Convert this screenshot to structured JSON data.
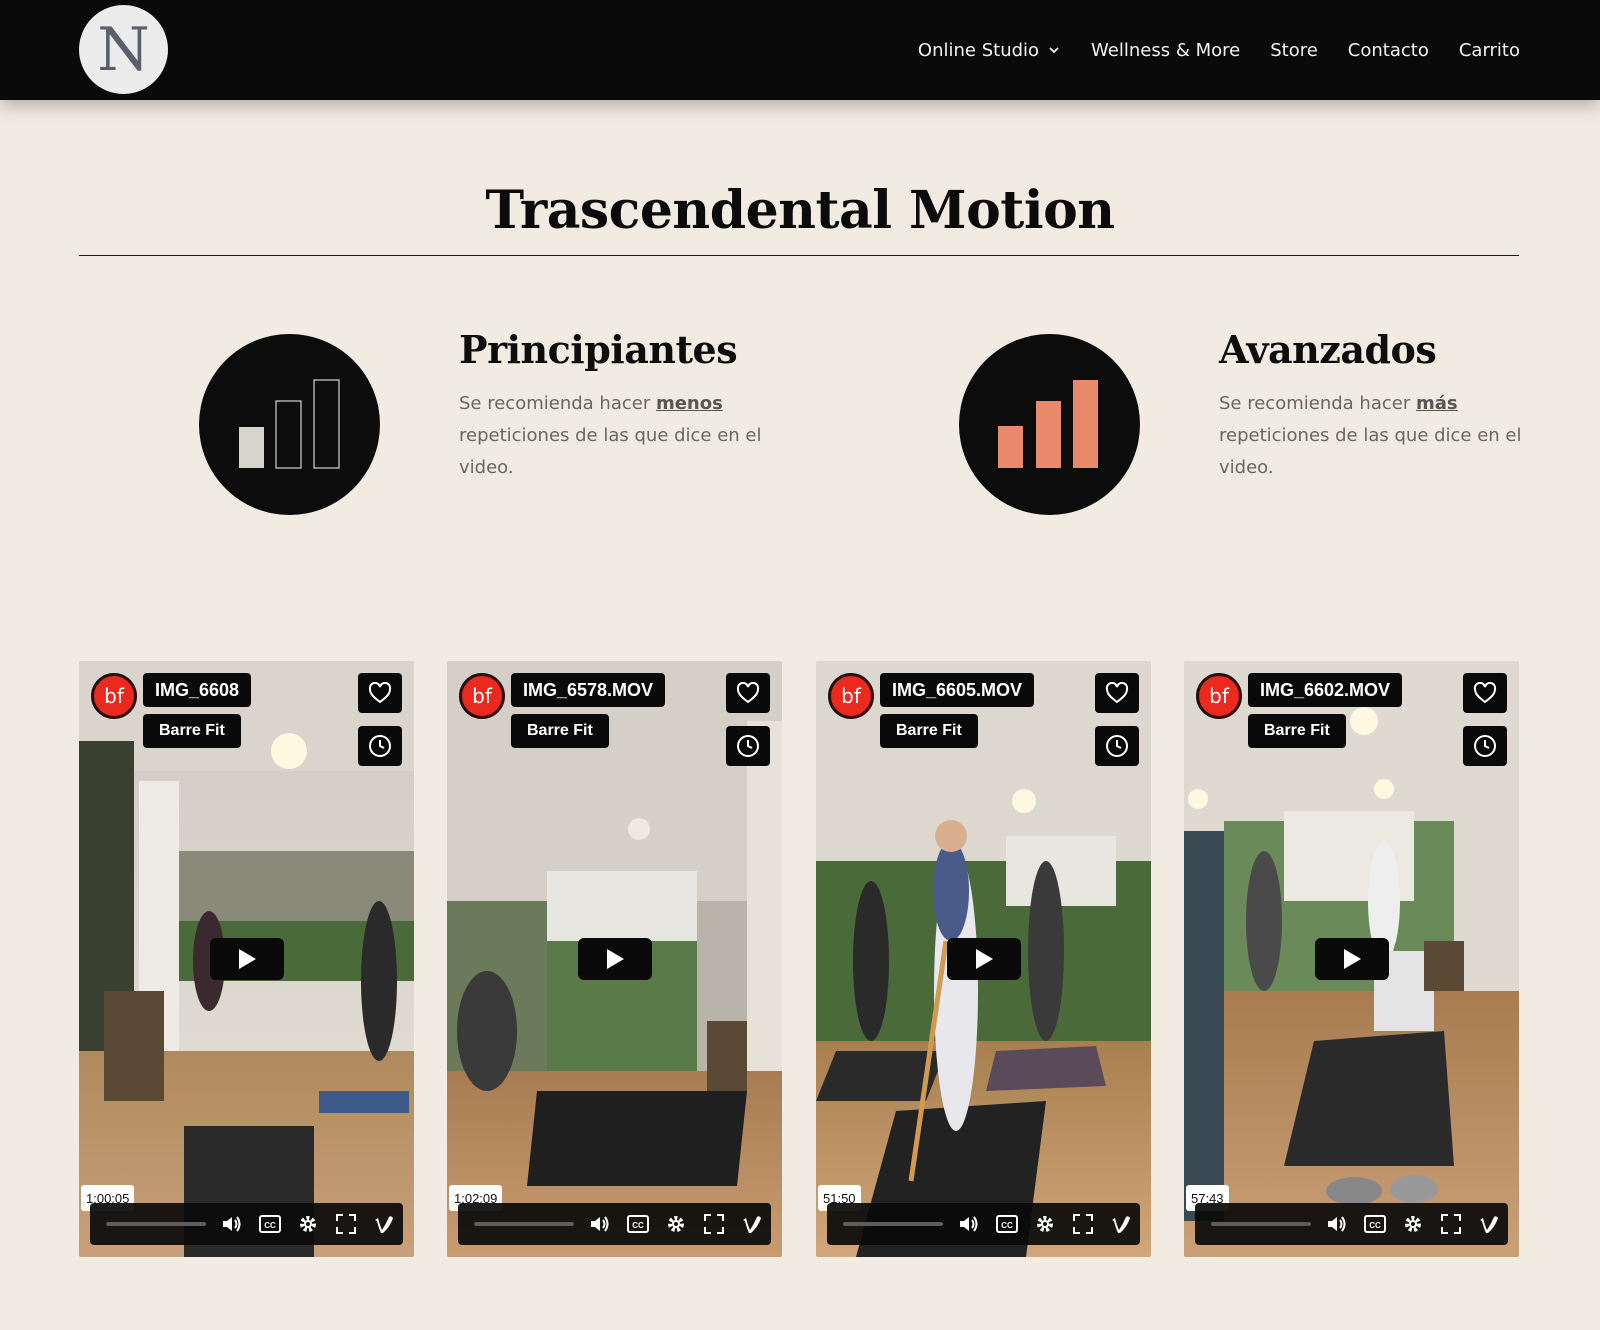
{
  "header": {
    "logo_letter": "N",
    "nav": [
      {
        "label": "Online Studio",
        "has_dropdown": true
      },
      {
        "label": "Wellness & More"
      },
      {
        "label": "Store"
      },
      {
        "label": "Contacto"
      },
      {
        "label": "Carrito"
      }
    ]
  },
  "page": {
    "title": "Trascendental Motion"
  },
  "levels": {
    "beginner": {
      "title": "Principiantes",
      "desc_prefix": "Se recomienda hacer ",
      "desc_emphasis": "menos",
      "desc_suffix": " repeticiones de las que dice en el video.",
      "icon": "signal-low-icon"
    },
    "advanced": {
      "title": "Avanzados",
      "desc_prefix": "Se recomienda hacer ",
      "desc_emphasis": "más",
      "desc_suffix": " repeticiones de las que dice en el video.",
      "icon": "signal-full-icon",
      "accent": "#e8896a"
    }
  },
  "videos": [
    {
      "title": "IMG_6608",
      "tag": "Barre Fit",
      "duration": "1:00:05",
      "badge": "bf"
    },
    {
      "title": "IMG_6578.MOV",
      "tag": "Barre Fit",
      "duration": "1:02:09",
      "badge": "bf"
    },
    {
      "title": "IMG_6605.MOV",
      "tag": "Barre Fit",
      "duration": "51:50",
      "badge": "bf"
    },
    {
      "title": "IMG_6602.MOV",
      "tag": "Barre Fit",
      "duration": "57:43",
      "badge": "bf"
    }
  ]
}
